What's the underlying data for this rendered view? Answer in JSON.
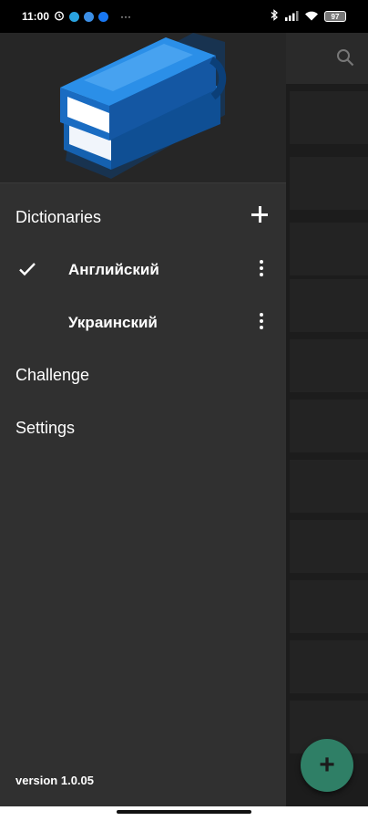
{
  "status_bar": {
    "time": "11:00",
    "more": "···",
    "battery": "97"
  },
  "drawer": {
    "dictionaries_label": "Dictionaries",
    "dictionaries": [
      {
        "name": "Английский",
        "selected": true
      },
      {
        "name": "Украинский",
        "selected": false
      }
    ],
    "challenge_label": "Challenge",
    "settings_label": "Settings",
    "version": "version 1.0.05"
  },
  "fab": {
    "label": "+"
  },
  "colors": {
    "drawer_bg": "#303030",
    "fab": "#2f7f66",
    "logo_blue": "#1e7fd6"
  }
}
